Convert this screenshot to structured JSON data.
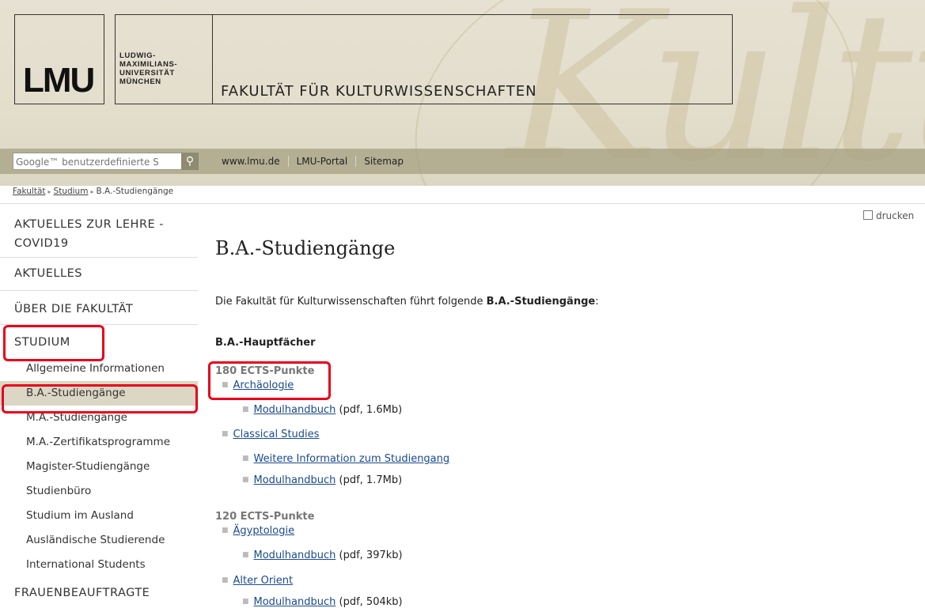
{
  "header": {
    "logo_text": "LMU",
    "university_name": "LUDWIG-\nMAXIMILIANS-\nUNIVERSITÄT\nMÜNCHEN",
    "faculty_title": "FAKULTÄT FÜR KULTURWISSENSCHAFTEN",
    "decor_text": "Kultu"
  },
  "navbar": {
    "search_placeholder": "Google™ benutzerdefinierte S",
    "links": [
      "www.lmu.de",
      "LMU-Portal",
      "Sitemap"
    ]
  },
  "breadcrumb": [
    "Fakultät",
    "Studium",
    "B.A.-Studiengänge"
  ],
  "sidebar": {
    "top_items": [
      "AKTUELLES ZUR LEHRE - COVID19",
      "AKTUELLES",
      "ÜBER DIE FAKULTÄT",
      "STUDIUM"
    ],
    "sub_items": [
      "Allgemeine Informationen",
      "B.A.-Studiengänge",
      "M.A.-Studiengänge",
      "M.A.-Zertifikatsprogramme",
      "Magister-Studiengänge",
      "Studienbüro",
      "Studium im Ausland",
      "Ausländische Studierende",
      "International Students"
    ],
    "active_sub": "B.A.-Studiengänge",
    "last_item": "FRAUENBEAUFTRAGTE"
  },
  "main": {
    "print_label": "drucken",
    "title": "B.A.-Studiengänge",
    "intro_text": "Die Fakultät für Kulturwissenschaften führt folgende ",
    "intro_bold": "B.A.-Studiengänge",
    "intro_end": ":",
    "section_heading": "B.A.-Hauptfächer",
    "groups": [
      {
        "ects": "180 ECTS-Punkte",
        "subjects": [
          {
            "name": "Archäologie",
            "links": [
              {
                "label": "Modulhandbuch",
                "suffix": " (pdf, 1.6Mb)"
              }
            ]
          },
          {
            "name": "Classical Studies",
            "links": [
              {
                "label": "Weitere Information zum Studiengang",
                "suffix": ""
              },
              {
                "label": "Modulhandbuch",
                "suffix": " (pdf, 1.7Mb)"
              }
            ]
          }
        ]
      },
      {
        "ects": "120 ECTS-Punkte",
        "subjects": [
          {
            "name": "Ägyptologie",
            "links": [
              {
                "label": "Modulhandbuch",
                "suffix": " (pdf, 397kb)"
              }
            ]
          },
          {
            "name": "Alter Orient",
            "links": [
              {
                "label": "Modulhandbuch",
                "suffix": " (pdf, 504kb)"
              }
            ]
          }
        ]
      }
    ]
  },
  "colors": {
    "highlight": "#e8001c",
    "link": "#1a4a8a",
    "nav_bar": "#a5a082",
    "active_bg": "#dcd7c5"
  }
}
